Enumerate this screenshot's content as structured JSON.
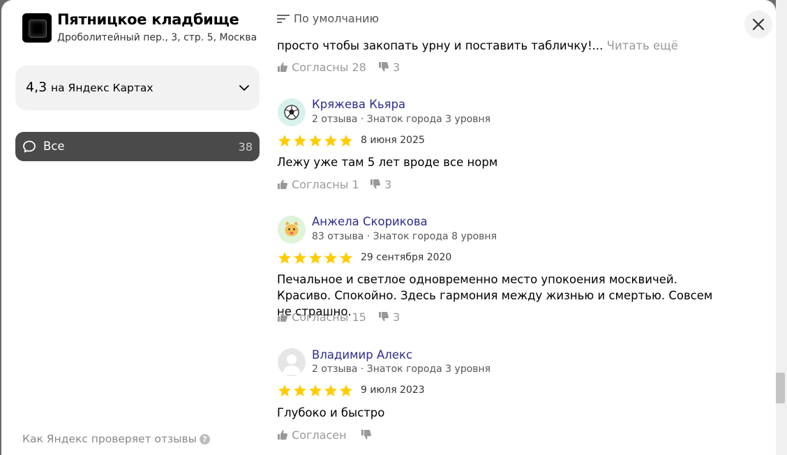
{
  "organization": {
    "title": "Пятницкое кладбище",
    "address": "Дроболитейный пер., 3, стр. 5, Москва"
  },
  "rating": {
    "value": "4,3",
    "source": "на Яндекс Картах"
  },
  "filter": {
    "label": "Все",
    "count": "38"
  },
  "footer": {
    "how_check": "Как Яндекс проверяет отзывы",
    "help_glyph": "?"
  },
  "sort": {
    "label": "По умолчанию"
  },
  "first_review": {
    "text": "просто чтобы закопать урну и поставить табличку!...",
    "read_more": "Читать ещё",
    "agree": "Согласны 28",
    "disagree": "3"
  },
  "reviews": [
    {
      "author": "Кряжева Кьяра",
      "meta": "2 отзыва · Знаток города 3 уровня",
      "stars": 5,
      "date": "8 июня 2025",
      "text": "Лежу уже там 5 лет вроде все норм",
      "agree": "Согласны 1",
      "disagree": "3",
      "avatar_icon": "soccer-ball-icon"
    },
    {
      "author": "Анжела Скорикова",
      "meta": "83 отзыва · Знаток города 8 уровня",
      "stars": 5,
      "date": "29 сентября 2020",
      "text": "Печальное и светлое одновременно место упокоения москвичей. Красиво. Спокойно. Здесь гармония между жизнью и смертью. Совсем не страшно.",
      "agree": "Согласны 15",
      "disagree": "3",
      "avatar_icon": "cat-face-icon"
    },
    {
      "author": "Владимир Алекс",
      "meta": "2 отзыва · Знаток города 3 уровня",
      "stars": 5,
      "date": "9 июля 2023",
      "text": "Глубоко и быстро",
      "agree": "Согласен",
      "disagree": "",
      "avatar_icon": "default-user-icon"
    }
  ],
  "colors": {
    "star": "#fc0",
    "author_link": "#2d2d8f",
    "filter_active_bg": "#4a4a4a"
  }
}
